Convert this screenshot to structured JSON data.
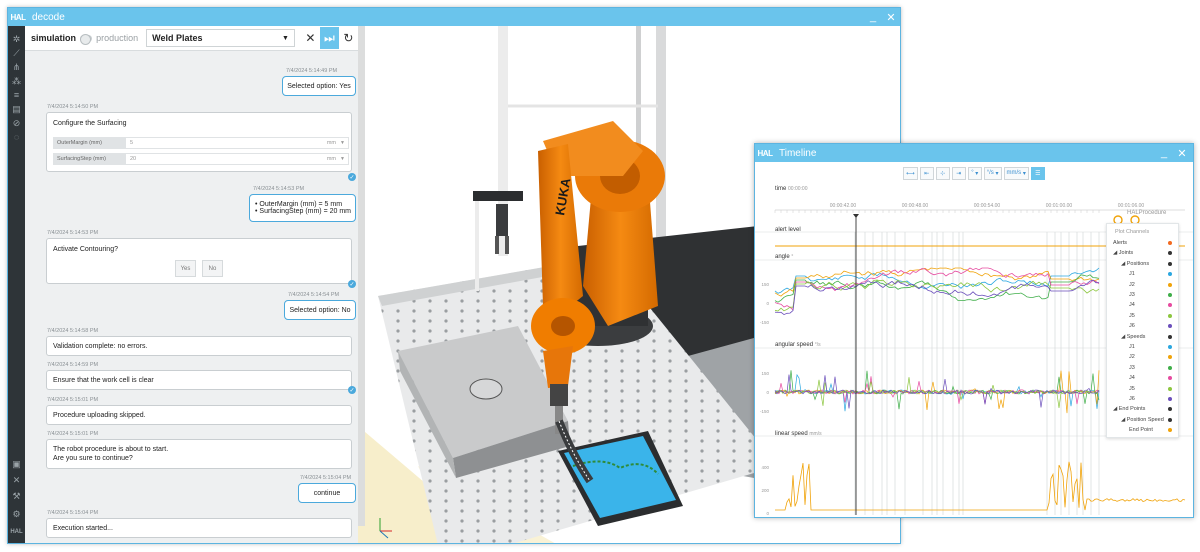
{
  "main_window": {
    "logo": "HAL",
    "title": "decode",
    "minimize": "_",
    "close": "✕"
  },
  "chat_topbar": {
    "simulation_label": "simulation",
    "production_label": "production",
    "procedure_select": "Weld Plates"
  },
  "chat": {
    "ts1": "7/4/2024 5:14:49 PM",
    "msg1": "Selected option: Yes",
    "ts2": "7/4/2024 5:14:50 PM",
    "surf_title": "Configure the Surfacing",
    "outer_label": "OuterMargin (mm)",
    "outer_value": "5",
    "outer_unit": "mm",
    "step_label": "SurfacingStep (mm)",
    "step_value": "20",
    "step_unit": "mm",
    "ts3": "7/4/2024 5:14:53 PM",
    "msg3a": "• OuterMargin (mm) = 5 mm",
    "msg3b": "• SurfacingStep (mm) = 20 mm",
    "ts4": "7/4/2024 5:14:53 PM",
    "contour_q": "Activate Contouring?",
    "yes": "Yes",
    "no": "No",
    "ts5": "7/4/2024 5:14:54 PM",
    "msg5": "Selected option: No",
    "ts6": "7/4/2024 5:14:58 PM",
    "msg6": "Validation complete: no errors.",
    "ts7": "7/4/2024 5:14:59 PM",
    "msg7": "Ensure that the work cell is clear",
    "ts8": "7/4/2024 5:15:01 PM",
    "msg8": "Procedure uploading skipped.",
    "ts9": "7/4/2024 5:15:01 PM",
    "msg9a": "The robot procedure is about to start.",
    "msg9b": "Are you sure to continue?",
    "ts10": "7/4/2024 5:15:04 PM",
    "msg10": "continue",
    "ts11": "7/4/2024 5:15:04 PM",
    "msg11": "Execution started..."
  },
  "robot_brand": "KUKA",
  "timeline_window": {
    "logo": "HAL",
    "title": "Timeline",
    "minimize": "_",
    "close": "✕",
    "unit_deg": "°",
    "unit_degs": "°/s",
    "unit_mms": "mm/s",
    "time_label": "time",
    "time_value": "00:00:00",
    "time_ticks": [
      "00:00:42.00",
      "00:00:48.00",
      "00:00:54.00",
      "00:01:00.00",
      "00:01:06.00"
    ],
    "hal_procedure": "HALProcedure",
    "alert_label": "alert level",
    "angle_label": "angle",
    "angle_unit": "°",
    "angspeed_label": "angular speed",
    "angspeed_unit": "°/s",
    "linspeed_label": "linear speed",
    "linspeed_unit": "mm/s",
    "angle_ticks": [
      "150",
      "0",
      "-150"
    ],
    "angspeed_ticks": [
      "150",
      "0",
      "-150"
    ],
    "linspeed_ticks": [
      "400",
      "200",
      "0"
    ]
  },
  "legend": {
    "header": "Plot Channels",
    "items": [
      {
        "label": "Alerts",
        "indent": 0,
        "color": "#f26a21"
      },
      {
        "label": "◢ Joints",
        "indent": 0,
        "color": "#333333"
      },
      {
        "label": "◢ Positions",
        "indent": 1,
        "color": "#333333"
      },
      {
        "label": "J1",
        "indent": 2,
        "color": "#2ca7e0"
      },
      {
        "label": "J2",
        "indent": 2,
        "color": "#f0a30a"
      },
      {
        "label": "J3",
        "indent": 2,
        "color": "#3fae49"
      },
      {
        "label": "J4",
        "indent": 2,
        "color": "#e64ba0"
      },
      {
        "label": "J5",
        "indent": 2,
        "color": "#8cc63f"
      },
      {
        "label": "J6",
        "indent": 2,
        "color": "#6b4fbb"
      },
      {
        "label": "◢ Speeds",
        "indent": 1,
        "color": "#333333"
      },
      {
        "label": "J1",
        "indent": 2,
        "color": "#2ca7e0"
      },
      {
        "label": "J2",
        "indent": 2,
        "color": "#f0a30a"
      },
      {
        "label": "J3",
        "indent": 2,
        "color": "#3fae49"
      },
      {
        "label": "J4",
        "indent": 2,
        "color": "#e64ba0"
      },
      {
        "label": "J5",
        "indent": 2,
        "color": "#8cc63f"
      },
      {
        "label": "J6",
        "indent": 2,
        "color": "#6b4fbb"
      },
      {
        "label": "◢ End Points",
        "indent": 0,
        "color": "#333333"
      },
      {
        "label": "◢ Position Speed",
        "indent": 1,
        "color": "#333333"
      },
      {
        "label": "End Point",
        "indent": 2,
        "color": "#f0a30a"
      }
    ]
  },
  "colors": {
    "accent": "#6ac4ec",
    "robot_orange": "#f07d00",
    "part_blue": "#3ab4ea"
  }
}
